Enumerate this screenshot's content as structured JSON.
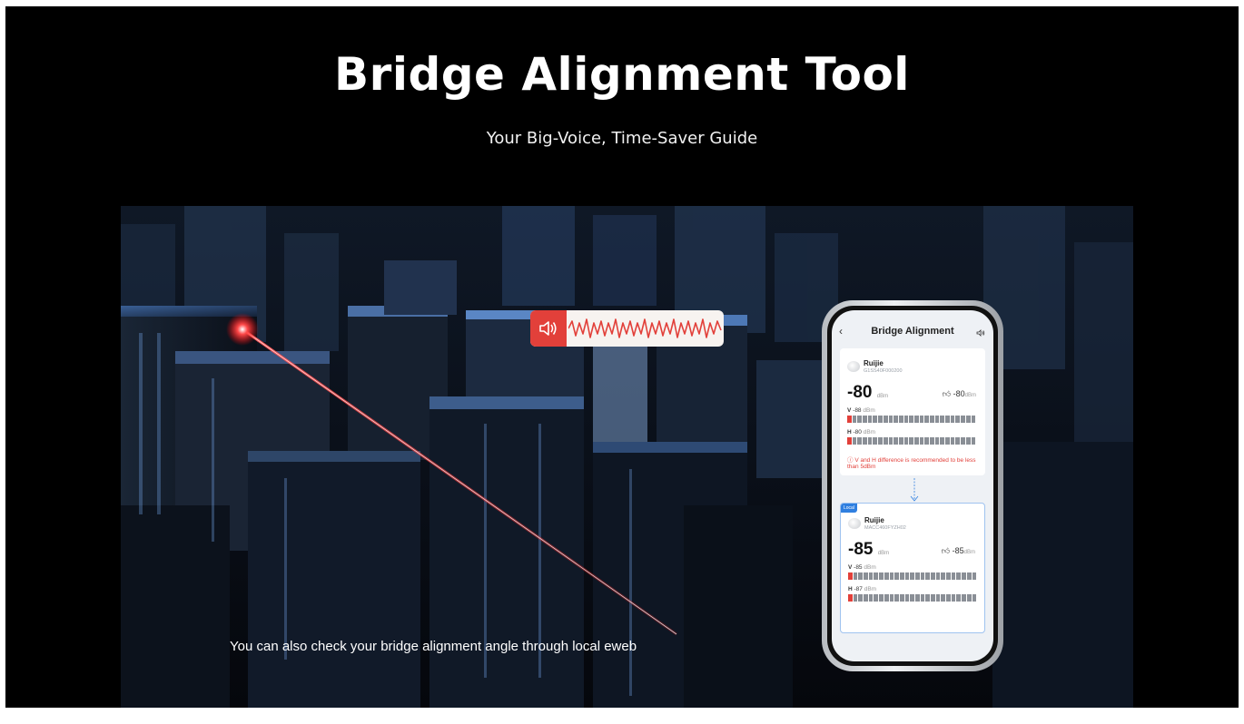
{
  "header": {
    "title": "Bridge Alignment Tool",
    "subtitle": "Your Big-Voice, Time-Saver Guide"
  },
  "video": {
    "caption": "You can also check your bridge alignment angle through local eweb"
  },
  "voice_indicator": {
    "icon": "speaker-icon",
    "accent": "#e2403a"
  },
  "phone_app": {
    "title": "Bridge Alignment",
    "back_icon": "chevron-left-icon",
    "sound_icon": "sound-icon",
    "remote": {
      "name": "Ruijie",
      "serial": "G1SS40F000200",
      "signal": "-80",
      "signal_unit": "dBm",
      "best": "-80",
      "best_unit": "dBm",
      "v_label": "V",
      "v_value": "-88",
      "v_unit": "dBm",
      "h_label": "H",
      "h_value": "-80",
      "h_unit": "dBm",
      "warning": "V and H difference is recommended to be less than 5dBm"
    },
    "local": {
      "tag": "Local",
      "name": "Ruijie",
      "serial": "MACC460FYZH02",
      "signal": "-85",
      "signal_unit": "dBm",
      "best": "-85",
      "best_unit": "dBm",
      "v_label": "V",
      "v_value": "-85",
      "v_unit": "dBm",
      "h_label": "H",
      "h_value": "-87",
      "h_unit": "dBm"
    }
  },
  "colors": {
    "background": "#000000",
    "accent_red": "#e2403a",
    "laser": "#ff3b3b",
    "link_blue": "#2f7fe0"
  }
}
